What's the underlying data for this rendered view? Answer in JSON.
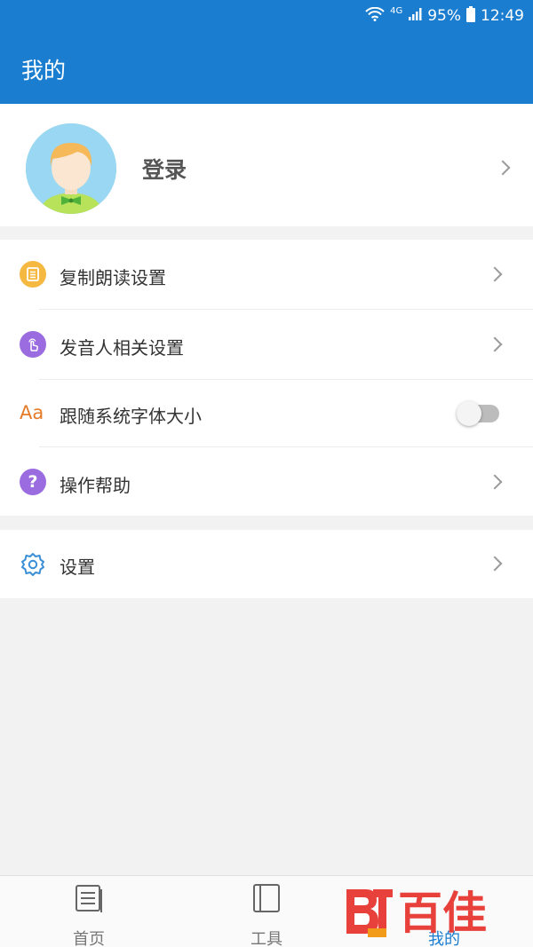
{
  "status_bar": {
    "network": "4G",
    "battery": "95%",
    "time": "12:49"
  },
  "header": {
    "title": "我的"
  },
  "profile": {
    "login_label": "登录"
  },
  "menu": {
    "items": [
      {
        "label": "复制朗读设置",
        "icon": "document-icon",
        "icon_color": "#f5b942"
      },
      {
        "label": "发音人相关设置",
        "icon": "hand-tap-icon",
        "icon_color": "#9b6ce0"
      },
      {
        "label": "跟随系统字体大小",
        "icon": "font-size-icon",
        "icon_color": "#e47b2b",
        "icon_text": "Aa",
        "toggle_on": false
      },
      {
        "label": "操作帮助",
        "icon": "question-icon",
        "icon_color": "#9b6ce0",
        "icon_text": "?"
      }
    ]
  },
  "settings": {
    "label": "设置",
    "icon": "gear-icon",
    "icon_color": "#3b8fd6"
  },
  "bottom_nav": {
    "items": [
      {
        "label": "首页",
        "icon": "home-list-icon"
      },
      {
        "label": "工具",
        "icon": "notebook-icon"
      },
      {
        "label": "我的",
        "icon": "user-icon",
        "active": true
      }
    ]
  },
  "watermark": {
    "text": "百佳",
    "brand_color": "#e8413b"
  }
}
